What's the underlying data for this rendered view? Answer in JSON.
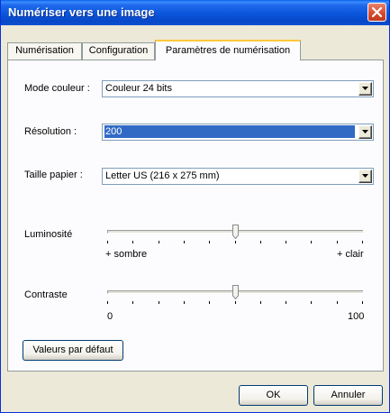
{
  "window": {
    "title": "Numériser vers une image"
  },
  "tabs": [
    {
      "label": "Numérisation"
    },
    {
      "label": "Configuration"
    },
    {
      "label": "Paramètres de numérisation"
    }
  ],
  "settings": {
    "color_mode": {
      "label": "Mode couleur :",
      "value": "Couleur 24 bits"
    },
    "resolution": {
      "label": "Résolution :",
      "value": "200"
    },
    "paper_size": {
      "label": "Taille papier :",
      "value": "Letter US (216 x 275 mm)"
    },
    "brightness": {
      "label": "Luminosité",
      "min_label": "+ sombre",
      "max_label": "+ clair",
      "level_fraction": 0.5
    },
    "contrast": {
      "label": "Contraste",
      "min_label": "0",
      "max_label": "100",
      "level_fraction": 0.5
    },
    "defaults_button": "Valeurs par défaut"
  },
  "footer": {
    "ok_label": "OK",
    "cancel_label": "Annuler"
  },
  "colors": {
    "titlebar": "#0A55DC",
    "selection": "#316AC5",
    "active_tab_accent": "#FFC83C",
    "close_button": "#D24A2E"
  },
  "icons": {
    "close": "close-icon",
    "dropdown": "chevron-down-icon"
  }
}
